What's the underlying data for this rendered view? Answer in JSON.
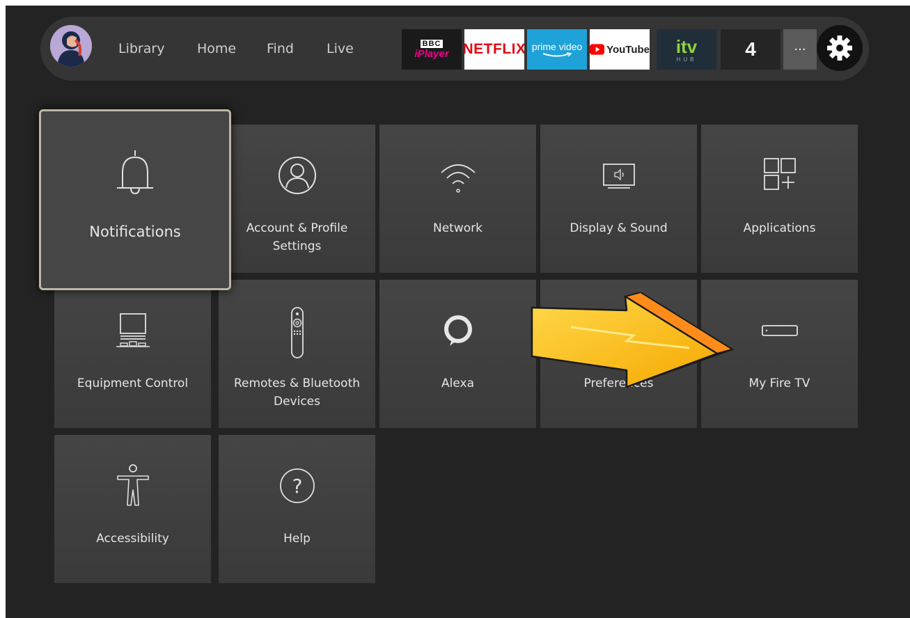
{
  "navbar": {
    "items": [
      {
        "label": "Library"
      },
      {
        "label": "Home"
      },
      {
        "label": "Find"
      },
      {
        "label": "Live"
      }
    ],
    "apps": [
      {
        "line1": "BBC",
        "line2": "iPlayer",
        "bg": "#1a1a1a",
        "fg": "#ec008c"
      },
      {
        "line1": "NETFLIX",
        "bg": "#ffffff",
        "fg": "#e50914"
      },
      {
        "line1": "prime video",
        "bg": "#1ea2d8",
        "fg": "#ffffff"
      },
      {
        "line1": "YouTube",
        "bg": "#ffffff",
        "fg": "#222222"
      },
      {
        "line1": "itv",
        "line2": "HUB",
        "bg": "#202e3a",
        "fg": "#8fd33d"
      },
      {
        "line1": "4",
        "bg": "#252525",
        "fg": "#f3f3f3"
      }
    ],
    "more_label": "···"
  },
  "tiles": [
    {
      "label": "Notifications",
      "icon": "bell-icon"
    },
    {
      "label": "Account & Profile Settings",
      "icon": "profile-icon"
    },
    {
      "label": "Network",
      "icon": "wifi-icon"
    },
    {
      "label": "Display & Sound",
      "icon": "display-sound-icon"
    },
    {
      "label": "Applications",
      "icon": "applications-icon"
    },
    {
      "label": "Equipment Control",
      "icon": "equipment-icon"
    },
    {
      "label": "Remotes & Bluetooth Devices",
      "icon": "remote-icon"
    },
    {
      "label": "Alexa",
      "icon": "alexa-icon"
    },
    {
      "label": "Preferences",
      "icon": "preferences-icon"
    },
    {
      "label": "My Fire TV",
      "icon": "fire-tv-stick-icon"
    },
    {
      "label": "Accessibility",
      "icon": "accessibility-icon"
    },
    {
      "label": "Help",
      "icon": "help-icon"
    }
  ],
  "colors": {
    "background": "#232323",
    "tile": "#3e3e3e",
    "focus_border": "#bdb7a6",
    "arrow": "#f7b500"
  }
}
